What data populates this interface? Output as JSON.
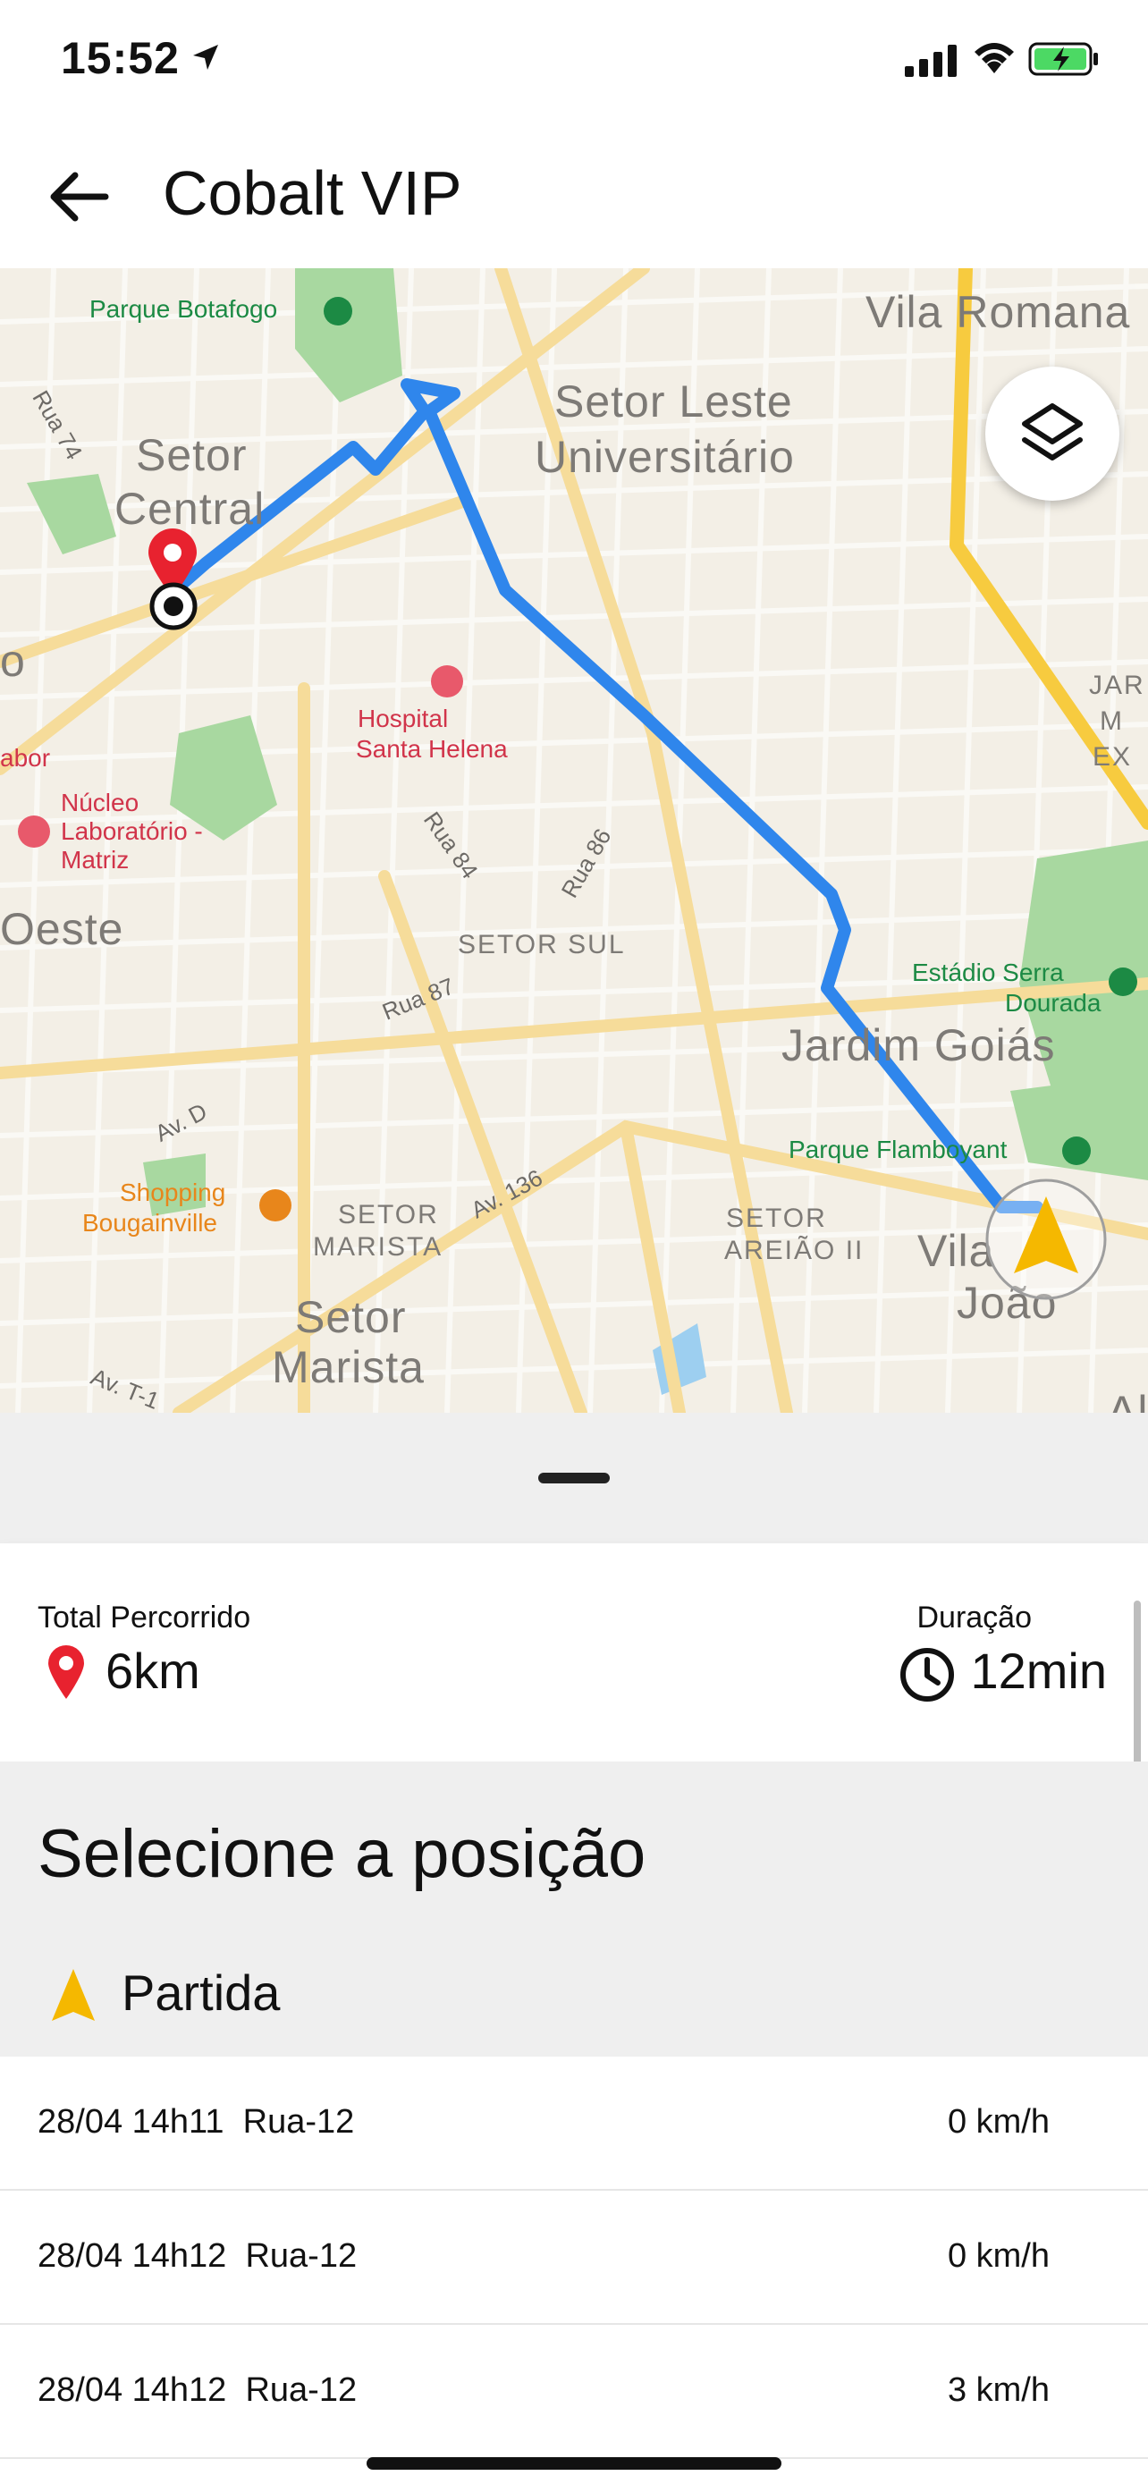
{
  "status_bar": {
    "time": "15:52"
  },
  "header": {
    "title": "Cobalt VIP"
  },
  "map": {
    "labels": {
      "parque_botafogo": "Parque Botafogo",
      "vila_romana": "Vila Romana",
      "setor_leste_1": "Setor Leste",
      "setor_leste_2": "Universitário",
      "rua_74": "Rua 74",
      "setor_central_1": "Setor",
      "setor_central_2": "Central",
      "jar": "JAR",
      "m": "M",
      "ex": "EX",
      "hospital_1": "Hospital",
      "hospital_2": "Santa Helena",
      "abor": "abor",
      "nucleo_1": "Núcleo",
      "nucleo_2": "Laboratório -",
      "nucleo_3": "Matriz",
      "rua_84": "Rua 84",
      "rua_86": "Rua 86",
      "oeste": "Oeste",
      "setor_sul": "SETOR SUL",
      "estadio_1": "Estádio Serra",
      "estadio_2": "Dourada",
      "rua_87": "Rua 87",
      "jardim_goias": "Jardim Goiás",
      "av_d": "Av. D",
      "parque_flamboyant": "Parque Flamboyant",
      "shopping_1": "Shopping",
      "shopping_2": "Bougainville",
      "av_136": "Av. 136",
      "setor_marista_small_1": "SETOR",
      "setor_marista_small_2": "MARISTA",
      "setor_areiao_1": "SETOR",
      "setor_areiao_2": "AREIÃO II",
      "vila_joao_1": "Vila",
      "vila_joao_2": "João",
      "setor_marista_1": "Setor",
      "setor_marista_2": "Marista",
      "av_t1": "Av. T-1",
      "alt": "Alt",
      "o": "o"
    }
  },
  "summary": {
    "distance_label": "Total Percorrido",
    "distance_value": "6km",
    "duration_label": "Duração",
    "duration_value": "12min"
  },
  "selection": {
    "title": "Selecione a posição",
    "start_label": "Partida"
  },
  "positions": [
    {
      "datetime": "28/04 14h11",
      "street": "Rua-12",
      "speed": "0 km/h"
    },
    {
      "datetime": "28/04 14h12",
      "street": "Rua-12",
      "speed": "0 km/h"
    },
    {
      "datetime": "28/04 14h12",
      "street": "Rua-12",
      "speed": "3 km/h"
    }
  ],
  "colors": {
    "route": "#2f86ec",
    "marker_red": "#e8222f",
    "arrow_yellow": "#f5b800",
    "highway_yellow": "#f7cb3f",
    "park_green": "#a8d8a0"
  }
}
